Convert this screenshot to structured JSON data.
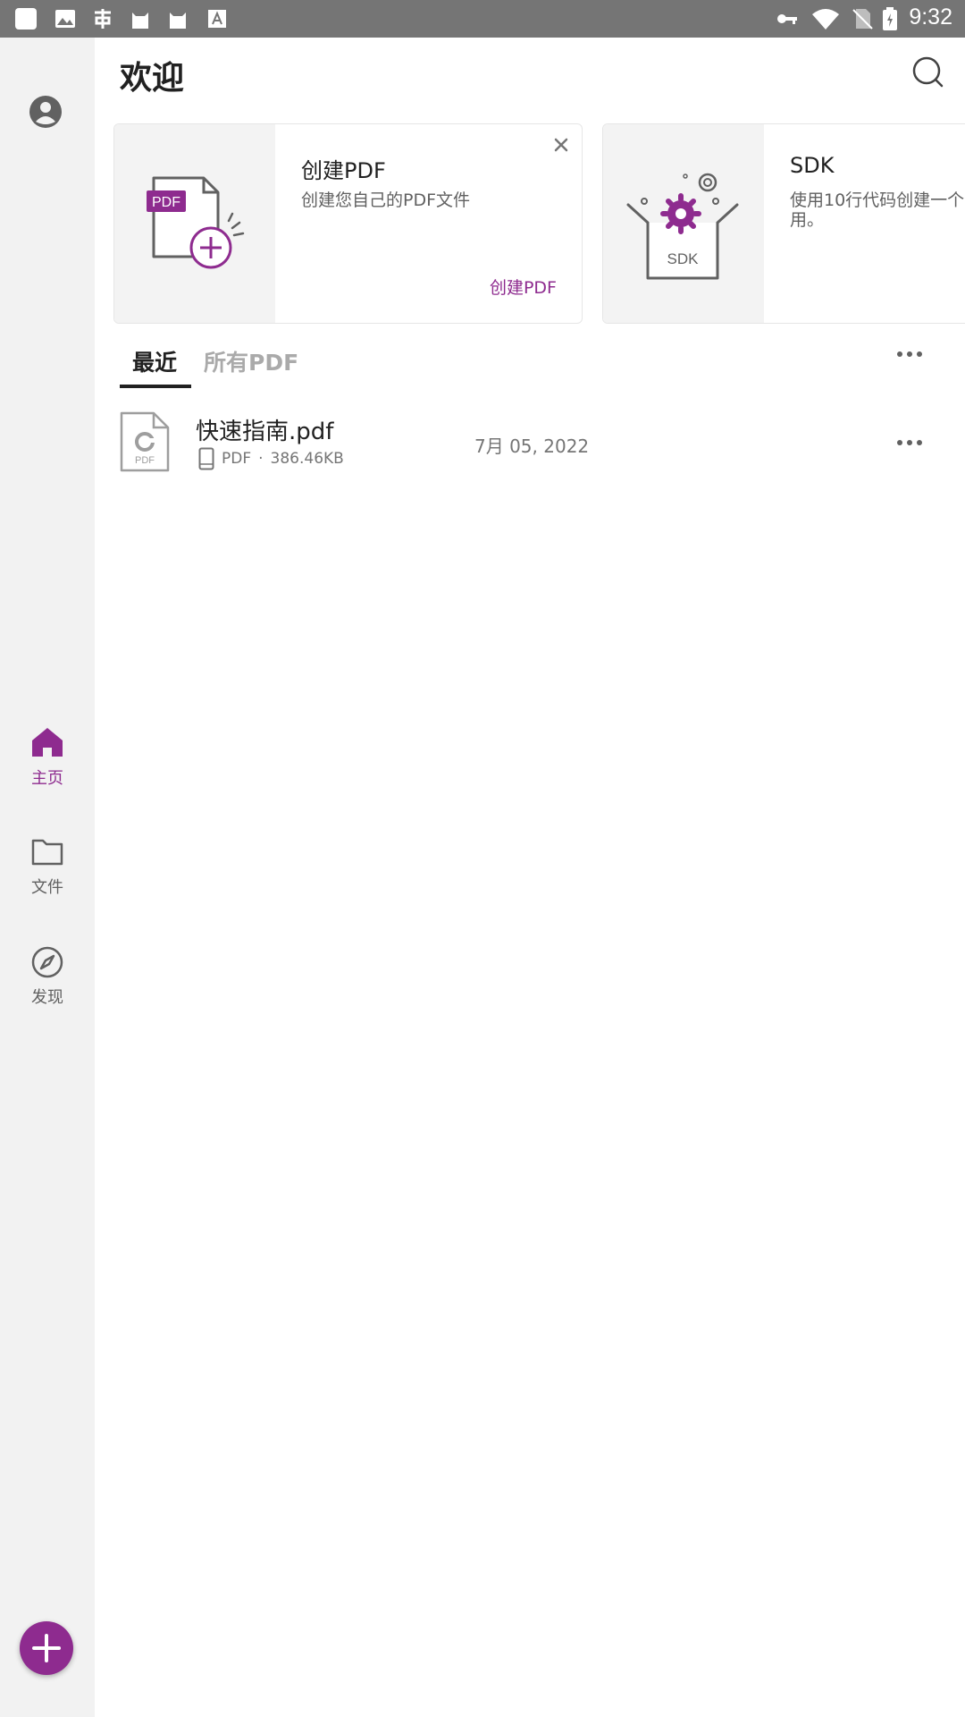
{
  "status_bar": {
    "time": "9:32",
    "left_icons": [
      "app-icon",
      "image-icon",
      "app-icon",
      "cat-icon",
      "cat-icon",
      "font-icon"
    ],
    "right_icons": [
      "key-icon",
      "wifi-icon",
      "no-sim-icon",
      "battery-icon"
    ]
  },
  "header": {
    "title": "欢迎"
  },
  "cards": [
    {
      "title": "创建PDF",
      "desc": "创建您自己的PDF文件",
      "action": "创建PDF",
      "art_label": "PDF"
    },
    {
      "title": "SDK",
      "desc": "使用10行代码创建一个\n用。",
      "art_label": "SDK"
    }
  ],
  "tabs": [
    {
      "label": "最近"
    },
    {
      "label": "所有PDF"
    }
  ],
  "files": [
    {
      "name": "快速指南.pdf",
      "type": "PDF",
      "size": "386.46KB",
      "date": "7月 05, 2022",
      "thumb_label": "PDF"
    }
  ],
  "nav": [
    {
      "label": "主页",
      "icon": "home-icon"
    },
    {
      "label": "文件",
      "icon": "folder-icon"
    },
    {
      "label": "发现",
      "icon": "compass-icon"
    }
  ],
  "colors": {
    "accent": "#8e2b8f",
    "rail": "#f2f2f2",
    "status_bar": "#757575"
  }
}
